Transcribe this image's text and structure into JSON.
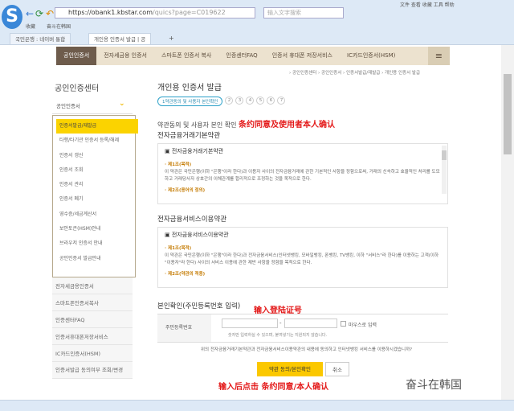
{
  "browser": {
    "logo": "S",
    "url_host": "https://obank1.kbstar.com",
    "url_path": "/quics?page=C019622",
    "search_placeholder": "输入文字搜索",
    "menu": "文件 查看 收藏 工具 帮助",
    "bookmarks": [
      "收藏",
      "奋斗在韩国"
    ],
    "tabs": [
      "국민은행 : 네이버 통합",
      "개인용 인증서 발급 | 공"
    ],
    "new_tab": "+"
  },
  "topnav": {
    "items": [
      "공인인증서",
      "전자세금용 인증서",
      "스마트폰 인증서 복사",
      "인증센터FAQ",
      "인증서 휴대폰 저장서비스",
      "IC카드인증서(HSM)"
    ],
    "menu_icon": "≡"
  },
  "breadcrumb": "› 공인인증센터 › 공인인증서 › 인증서발급/재발급 › 개인용 인증서 발급",
  "sidebar": {
    "title": "공인인증센터",
    "selected": "공인인증서",
    "sub": [
      "인증서발급/재발급",
      "타행/타기관 인증서 등록/해제",
      "인증서 갱신",
      "인증서 조회",
      "인증서 관리",
      "인증서 폐기",
      "영수증/세금계산서",
      "보안토큰(HSM)안내",
      "브라우저 인증서 안내",
      "공인인증서 발급안내"
    ],
    "lower": [
      "전자세금용인증서",
      "스마트폰인증서복사",
      "인증센터FAQ",
      "인증서휴대폰저장서비스",
      "IC카드인증서(HSM)",
      "인증서발급 동의여부 조회/변경"
    ]
  },
  "main": {
    "title": "개인용 인증서 발급",
    "step1": "1약관동의 및 사용자 본인확인",
    "steps": [
      "2",
      "3",
      "4",
      "5",
      "6",
      "7"
    ],
    "heading": "약관동의 및 사용자 본인 확인",
    "heading_note": "条约同意及使用者本人确认",
    "sec1": {
      "title": "전자금융거래기본약관",
      "box_title": "▣ 전자금융거래기본약관",
      "a1": "· 제1조(목적)",
      "p1": "이 약관은 국민은행(이하 \"은행\"이라 한다)과 이용자 사이의 전자금융거래에 관한 기본적인 사항을 정함으로써, 거래의 신속하고 효율적인 처리를 도모하고 거래당사자 상호간의 이해관계를 합리적으로 조정하는 것을 목적으로 한다.",
      "a2": "· 제2조(용어의 정의)"
    },
    "sec2": {
      "title": "전자금융서비스이용약관",
      "box_title": "▣ 전자금융서비스이용약관",
      "a1": "· 제1조(목적)",
      "p1": "이 약관은 국민은행(이하 \"은행\"이라 한다)과 전자금융서비스(인터넷뱅킹, 모바일뱅킹, 폰뱅킹, TV뱅킹, 이하 \"서비스\"라 한다)를 이용하는 고객(이하 \"이용자\"라 한다) 사이의 서비스 이용에 관한 제반 사항을 정함을 목적으로 한다.",
      "a2": "· 제2조(약관의 적용)"
    },
    "id": {
      "title": "본인확인(주민등록번호 입력)",
      "note": "输入登陆证号",
      "label": "주민등록번호",
      "dash": "-",
      "mouse": "마우스로 입력",
      "hint": "숫자만 입력하실 수 있으며, 붙여넣기는 지원되지 않습니다."
    },
    "question": "위의 전자금융거래기본약관과 전자금융서비스이용약관의 내용에 동의하고 인터넷뱅킹 서비스를 이용하시겠습니까?",
    "confirm_button": "약관 동의/본인확인",
    "cancel_button": "취소",
    "bottom_note": "输入后点击 条约同意/本人确认"
  },
  "watermark": "奋斗在韩国"
}
